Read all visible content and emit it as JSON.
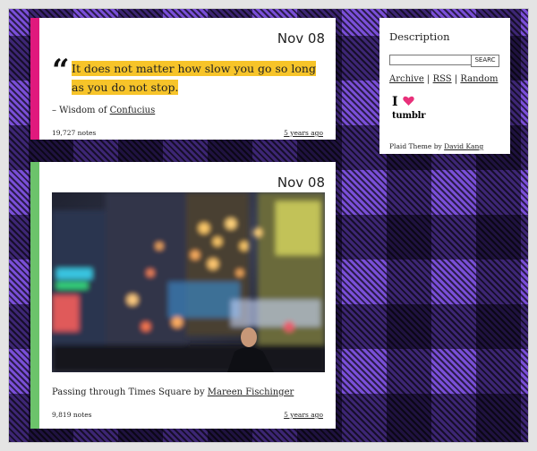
{
  "theme": {
    "accent_pink": "#e0197d",
    "accent_green": "#6cc36b",
    "highlight": "#f7c429",
    "plaid_purple": "#7a4fd8"
  },
  "quote_post": {
    "date": "Nov 08",
    "quote_mark": "“",
    "quote_text": "It does not matter how slow you go so long as you do not stop.",
    "source_prefix": "– Wisdom of ",
    "source_link": "Confucius",
    "notes": "19,727 notes",
    "time_ago": "5 years ago"
  },
  "photo_post": {
    "date": "Nov 08",
    "caption_prefix": "Passing through Times Square by ",
    "caption_link": "Mareen Fischinger",
    "notes": "9,819 notes",
    "time_ago": "5 years ago"
  },
  "sidebar": {
    "description": "Description",
    "search_value": "",
    "search_button": "SEARC",
    "links": [
      "Archive",
      "RSS",
      "Random"
    ],
    "separator": "|",
    "badge_i": "I",
    "heart_icon": "heart-icon",
    "badge_word": "tumblr",
    "credit_prefix": "Plaid Theme by ",
    "credit_link": "David Kang"
  }
}
